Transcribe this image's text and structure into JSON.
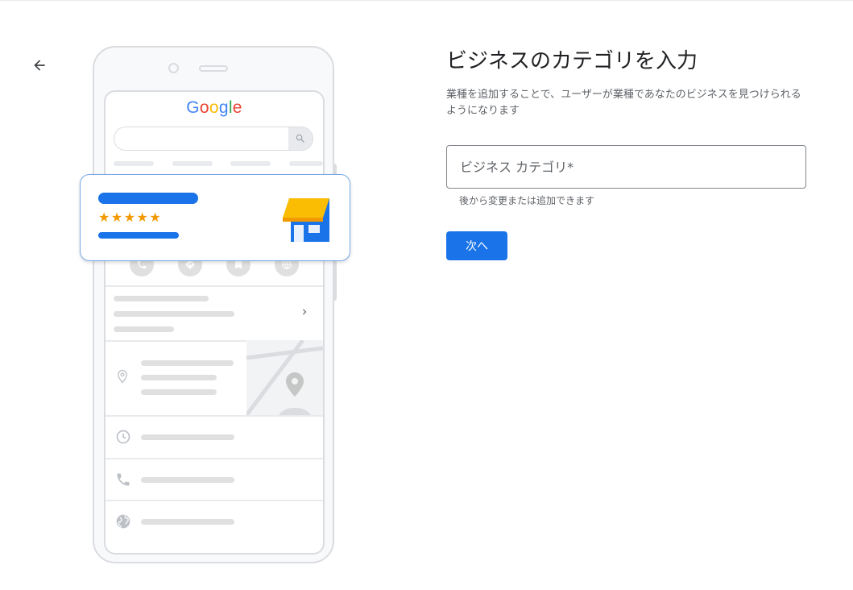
{
  "title": "ビジネスのカテゴリを入力",
  "description": "業種を追加することで、ユーザーが業種であなたのビジネスを見つけられるようになります",
  "category_field": {
    "placeholder": "ビジネス カテゴリ*",
    "value": "",
    "helper": "後から変更または追加できます"
  },
  "next_button": "次へ",
  "illustration": {
    "logo": "Google",
    "rating_stars": "★★★★★",
    "rating": 5
  },
  "icons": [
    "back-arrow-icon",
    "search-icon",
    "phone-icon",
    "directions-icon",
    "bookmark-icon",
    "web-icon",
    "chevron-right-icon",
    "location-pin-icon",
    "clock-icon",
    "globe-icon",
    "storefront-icon"
  ],
  "colors": {
    "accent": "#1a73e8",
    "star": "#f29900",
    "awning": "#fbbc04",
    "text_primary": "#202124",
    "text_secondary": "#5f6368"
  }
}
